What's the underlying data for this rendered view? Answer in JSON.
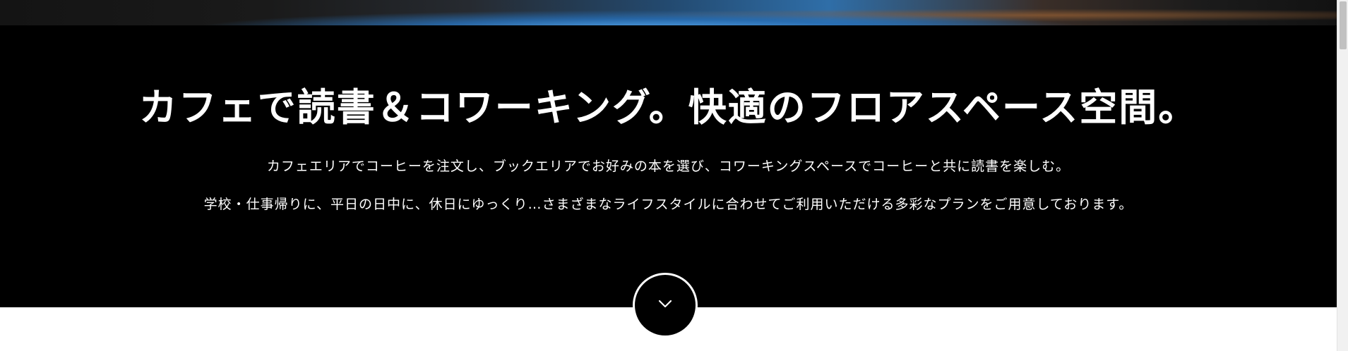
{
  "hero": {
    "headline": "カフェで読書＆コワーキング。快適のフロアスペース空間。",
    "lead_line_1": "カフェエリアでコーヒーを注文し、ブックエリアでお好みの本を選び、コワーキングスペースでコーヒーと共に読書を楽しむ。",
    "lead_line_2": "学校・仕事帰りに、平日の日中に、休日にゆっくり…さまざまなライフスタイルに合わせてご利用いただける多彩なプランをご用意しております。"
  },
  "scroll_button": {
    "icon": "chevron-down-icon"
  },
  "colors": {
    "band_background": "#000000",
    "text": "#ffffff",
    "page_background": "#ffffff"
  }
}
